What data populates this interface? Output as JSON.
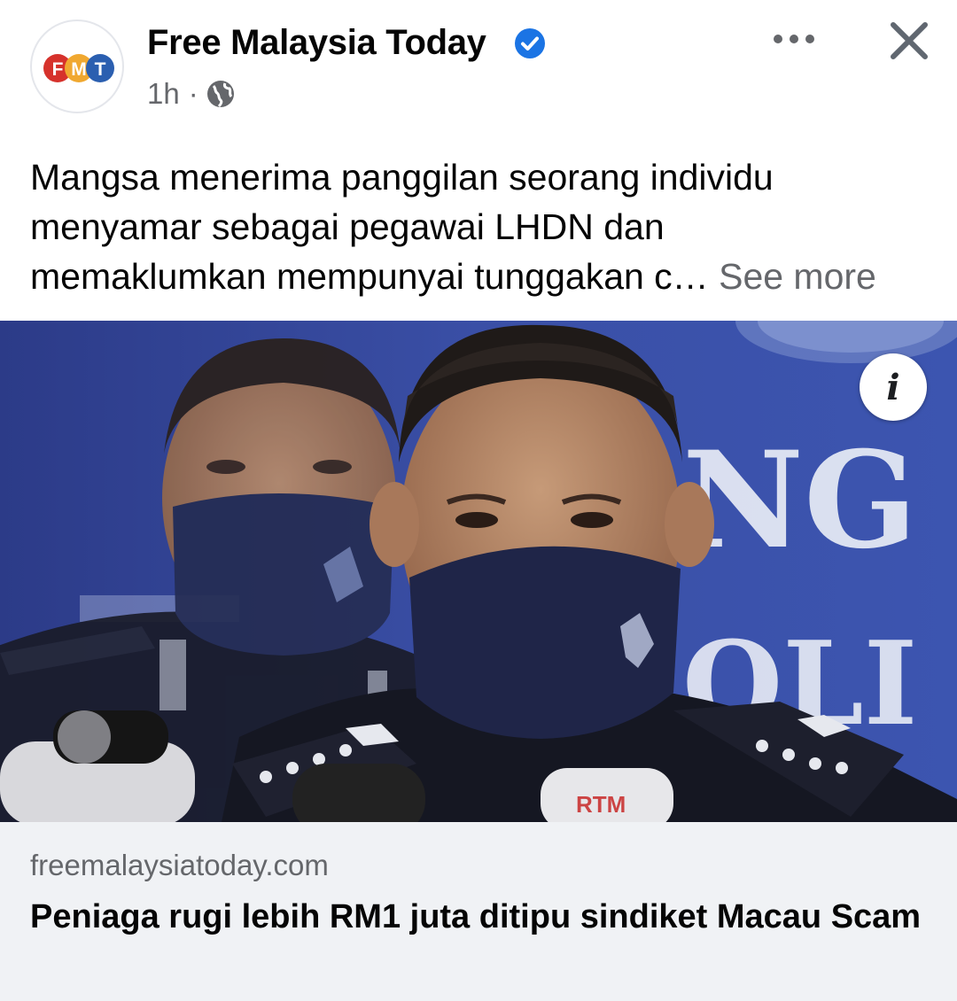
{
  "post": {
    "page_name": "Free Malaysia Today",
    "avatar_logo": {
      "letters": [
        "F",
        "M",
        "T"
      ],
      "colors": [
        "#d6322c",
        "#f0a830",
        "#2b5fb0"
      ]
    },
    "verified_icon": "verified-badge-icon",
    "timestamp": "1h",
    "separator": "·",
    "audience_icon": "globe-icon",
    "more_icon": "more-options-icon",
    "close_icon": "close-icon",
    "text_lines": [
      "Mangsa menerima panggilan seorang individu",
      "menyamar sebagai pegawai LHDN dan",
      "memaklumkan mempunyai tunggakan c…"
    ],
    "see_more": "See more",
    "accent_color": "#1b74e4"
  },
  "photo": {
    "backdrop_text_1": "NG M",
    "backdrop_text_2": "OLI",
    "mic_label": "RTM",
    "info_icon": "info-icon",
    "info_glyph": "i"
  },
  "link_preview": {
    "domain": "freemalaysiatoday.com",
    "headline": "Peniaga rugi lebih RM1 juta ditipu sindiket Macau Scam"
  }
}
